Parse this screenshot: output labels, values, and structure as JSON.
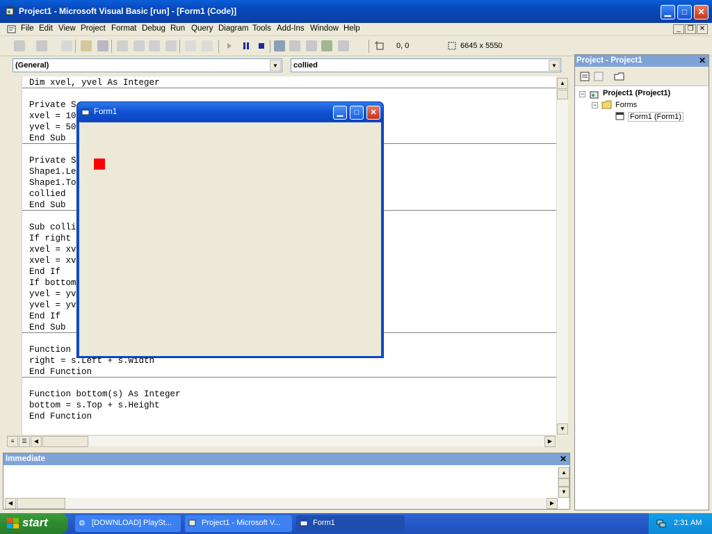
{
  "window": {
    "title": "Project1 - Microsoft Visual Basic [run] - [Form1 (Code)]"
  },
  "menu": {
    "items": [
      "File",
      "Edit",
      "View",
      "Project",
      "Format",
      "Debug",
      "Run",
      "Query",
      "Diagram",
      "Tools",
      "Add-Ins",
      "Window",
      "Help"
    ]
  },
  "toolbar": {
    "position": "0, 0",
    "size": "6645 x 5550"
  },
  "code": {
    "object_combo": "(General)",
    "proc_combo": "collied",
    "lines": [
      "Dim xvel, yvel As Integer",
      "Private S",
      "xvel = 10",
      "yvel = 50",
      "End Sub",
      "Private S",
      "Shape1.Le",
      "Shape1.To",
      "collied",
      "End Sub",
      "Sub colli",
      "If right",
      "xvel = xv",
      "xvel = xv",
      "End If",
      "If bottom",
      "yvel = yv",
      "yvel = yv",
      "End If",
      "End Sub",
      "Function",
      "right = s.Left + s.Width",
      "End Function",
      "Function bottom(s) As Integer",
      "bottom = s.Top + s.Height",
      "End Function"
    ]
  },
  "form1": {
    "title": "Form1",
    "shape_color": "#ff0000"
  },
  "project": {
    "title": "Project - Project1",
    "root": "Project1 (Project1)",
    "folder": "Forms",
    "item": "Form1 (Form1)"
  },
  "immediate": {
    "title": "Immediate"
  },
  "taskbar": {
    "start": "start",
    "tasks": [
      "[DOWNLOAD] PlaySt...",
      "Project1 - Microsoft V...",
      "Form1"
    ],
    "clock": "2:31 AM"
  },
  "colors": {
    "xp_blue": "#0848b8",
    "pane_title": "#7ea3d7",
    "start_green": "#2f8a2f"
  }
}
